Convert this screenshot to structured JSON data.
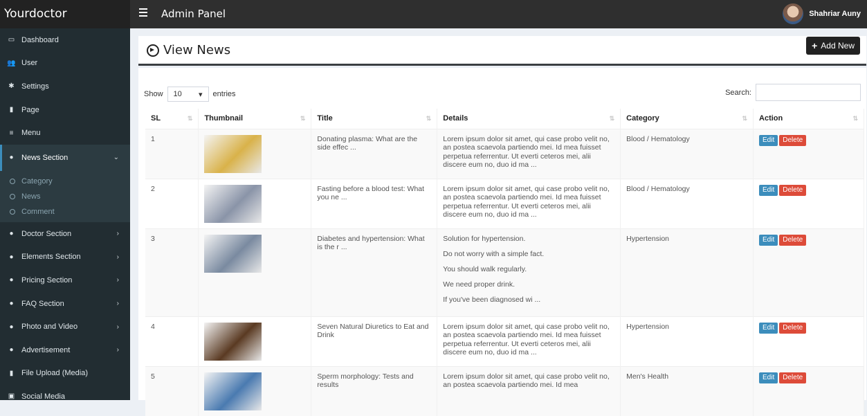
{
  "topbar": {
    "brand": "Yourdoctor",
    "title": "Admin Panel",
    "user_name": "Shahriar Auny"
  },
  "sidebar": {
    "items": [
      {
        "label": "Dashboard",
        "icon": "monitor-icon"
      },
      {
        "label": "User",
        "icon": "users-icon"
      },
      {
        "label": "Settings",
        "icon": "gear-icon"
      },
      {
        "label": "Page",
        "icon": "file-icon"
      },
      {
        "label": "Menu",
        "icon": "bars-icon"
      },
      {
        "label": "News Section",
        "icon": "pin-icon",
        "expanded": true,
        "sub": [
          {
            "label": "Category"
          },
          {
            "label": "News"
          },
          {
            "label": "Comment"
          }
        ]
      },
      {
        "label": "Doctor Section",
        "icon": "pin-icon",
        "chevron": true
      },
      {
        "label": "Elements Section",
        "icon": "pin-icon",
        "chevron": true
      },
      {
        "label": "Pricing Section",
        "icon": "pin-icon",
        "chevron": true
      },
      {
        "label": "FAQ Section",
        "icon": "pin-icon",
        "chevron": true
      },
      {
        "label": "Photo and Video",
        "icon": "pin-icon",
        "chevron": true
      },
      {
        "label": "Advertisement",
        "icon": "pin-icon",
        "chevron": true
      },
      {
        "label": "File Upload (Media)",
        "icon": "file-icon"
      },
      {
        "label": "Social Media",
        "icon": "social-icon"
      }
    ]
  },
  "page": {
    "title": "View News",
    "add_button": "Add New"
  },
  "table_controls": {
    "show_label": "Show",
    "page_size": "10",
    "entries_label": "entries",
    "search_label": "Search:"
  },
  "table": {
    "headers": [
      "SL",
      "Thumbnail",
      "Title",
      "Details",
      "Category",
      "Action"
    ],
    "rows": [
      {
        "sl": "1",
        "title": "Donating plasma: What are the side effec ...",
        "details": "Lorem ipsum dolor sit amet, qui case probo velit no, an postea scaevola partiendo mei. Id mea fuisset perpetua referrentur. Ut everti ceteros mei, alii discere eum no, duo id ma ...",
        "category": "Blood / Hematology",
        "thumb_color": "#d9b24a"
      },
      {
        "sl": "2",
        "title": "Fasting before a blood test: What you ne ...",
        "details": "Lorem ipsum dolor sit amet, qui case probo velit no, an postea scaevola partiendo mei. Id mea fuisset perpetua referrentur. Ut everti ceteros mei, alii discere eum no, duo id ma ...",
        "category": "Blood / Hematology",
        "thumb_color": "#8a94a8"
      },
      {
        "sl": "3",
        "title": "Diabetes and hypertension: What is the r ...",
        "details_lines": [
          "Solution for hypertension.",
          "Do not worry with a simple fact.",
          "You should walk regularly.",
          "We need proper drink.",
          "If you've been diagnosed wi ..."
        ],
        "category": "Hypertension",
        "thumb_color": "#7a8aa0"
      },
      {
        "sl": "4",
        "title": "Seven Natural Diuretics to Eat and Drink",
        "details": "Lorem ipsum dolor sit amet, qui case probo velit no, an postea scaevola partiendo mei. Id mea fuisset perpetua referrentur. Ut everti ceteros mei, alii discere eum no, duo id ma ...",
        "category": "Hypertension",
        "thumb_color": "#5a3a22"
      },
      {
        "sl": "5",
        "title": "Sperm morphology: Tests and results",
        "details": "Lorem ipsum dolor sit amet, qui case probo velit no, an postea scaevola partiendo mei. Id mea",
        "category": "Men's Health",
        "thumb_color": "#4a7ab0"
      }
    ],
    "edit_label": "Edit",
    "delete_label": "Delete"
  },
  "colors": {
    "accent": "#3c8dbc",
    "danger": "#dd4b39",
    "sidebar": "#222d32",
    "topbar": "#2f2f2f"
  }
}
